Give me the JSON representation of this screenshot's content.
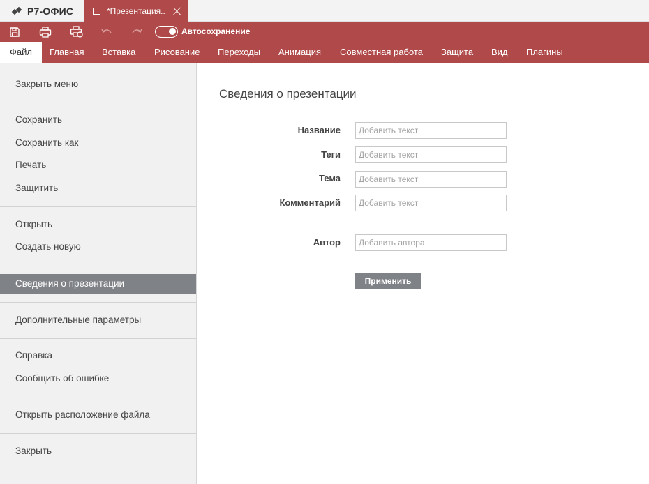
{
  "app": {
    "logo_text": "Р7-ОФИС"
  },
  "tab": {
    "title": "*Презентация..."
  },
  "toolbar": {
    "buttons": [
      "save-icon",
      "print-icon",
      "quick-print-icon",
      "undo-icon",
      "redo-icon"
    ],
    "autosave": {
      "label": "Автосохранение",
      "enabled": true
    }
  },
  "menu": {
    "items": [
      "Файл",
      "Главная",
      "Вставка",
      "Рисование",
      "Переходы",
      "Анимация",
      "Совместная работа",
      "Защита",
      "Вид",
      "Плагины"
    ],
    "active": "Файл"
  },
  "sidebar": {
    "items": [
      "Закрыть меню",
      "Сохранить",
      "Сохранить как",
      "Печать",
      "Защитить",
      "Открыть",
      "Создать новую",
      "Сведения о презентации",
      "Дополнительные параметры",
      "Справка",
      "Сообщить об ошибке",
      "Открыть расположение файла",
      "Закрыть"
    ],
    "active": "Сведения о презентации"
  },
  "info": {
    "title": "Сведения о презентации",
    "fields": [
      {
        "label": "Название",
        "value": "",
        "placeholder": "Добавить текст"
      },
      {
        "label": "Теги",
        "value": "",
        "placeholder": "Добавить текст"
      },
      {
        "label": "Тема",
        "value": "",
        "placeholder": "Добавить текст"
      },
      {
        "label": "Комментарий",
        "value": "",
        "placeholder": "Добавить текст"
      },
      {
        "label": "Автор",
        "value": "",
        "placeholder": "Добавить автора"
      }
    ],
    "apply_label": "Применить"
  },
  "colors": {
    "accent": "#b04a4a",
    "sidebar_bg": "#f1f1f1",
    "active_item": "#7f8287"
  }
}
